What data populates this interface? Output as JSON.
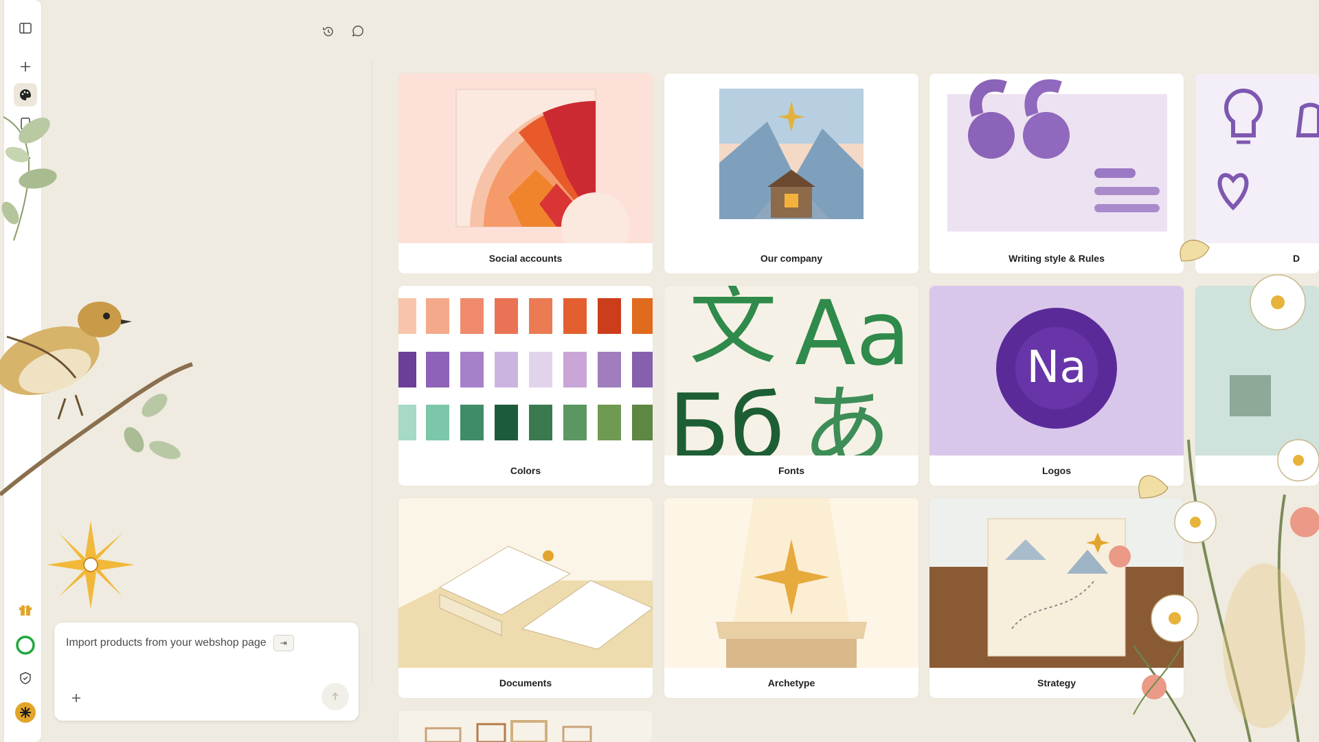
{
  "toolbar": {
    "history_icon": "history-icon",
    "comment_icon": "comment-icon"
  },
  "sidebar": {
    "items": [
      {
        "icon": "sidebar-toggle-icon"
      },
      {
        "icon": "plus-icon"
      },
      {
        "icon": "palette-icon",
        "active": true
      },
      {
        "icon": "document-icon"
      },
      {
        "icon": "chart-icon"
      }
    ],
    "bottom_items": [
      {
        "icon": "gift-icon"
      },
      {
        "icon": "status-ring-icon"
      },
      {
        "icon": "shield-check-icon"
      },
      {
        "icon": "sun-avatar-icon"
      }
    ]
  },
  "chat": {
    "placeholder": "Import products from your webshop page",
    "shortcut": "⇥"
  },
  "cards": [
    {
      "label": "Social accounts"
    },
    {
      "label": "Our company"
    },
    {
      "label": "Writing style & Rules"
    },
    {
      "label": "D"
    },
    {
      "label": "Colors"
    },
    {
      "label": "Fonts"
    },
    {
      "label": "Logos"
    },
    {
      "label": "Documents"
    },
    {
      "label": "Archetype"
    },
    {
      "label": "Strategy"
    }
  ],
  "fonts_card": {
    "glyph_cjk": "文",
    "glyph_latin": "Aa",
    "glyph_cyrillic": "Бб",
    "glyph_kana": "あ"
  },
  "logos_card": {
    "logo_text": "Na"
  },
  "colors": {
    "accent": "#7b3fb5",
    "background": "#efebe0",
    "green_status": "#1fa83b",
    "gold": "#e2a52b"
  }
}
